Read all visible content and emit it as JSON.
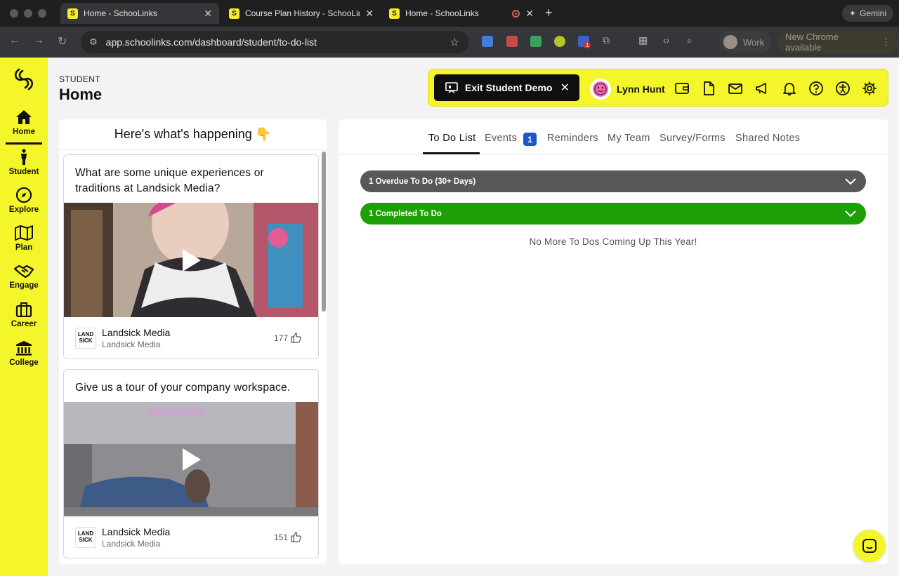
{
  "browser": {
    "tabs": [
      {
        "title": "Home - SchooLinks",
        "fav": "S"
      },
      {
        "title": "Course Plan History - SchooLinks",
        "fav": "S"
      },
      {
        "title": "Home - SchooLinks",
        "fav": "S"
      }
    ],
    "gemini_label": "Gemini",
    "url": "app.schoolinks.com/dashboard/student/to-do-list",
    "profile_label": "Work",
    "update_label": "New Chrome available",
    "ext_badge": "1"
  },
  "sidebar": {
    "items": [
      {
        "label": "Home"
      },
      {
        "label": "Student"
      },
      {
        "label": "Explore"
      },
      {
        "label": "Plan"
      },
      {
        "label": "Engage"
      },
      {
        "label": "Career"
      },
      {
        "label": "College"
      }
    ]
  },
  "header": {
    "subtitle": "STUDENT",
    "title": "Home",
    "exit_demo_label": "Exit Student Demo",
    "user_name": "Lynn Hunt"
  },
  "feed": {
    "title": "Here's what's happening 👇",
    "cards": [
      {
        "question": "What are some unique experiences or traditions at Landsick Media?",
        "org": "Landsick Media",
        "org_sub": "Landsick Media",
        "likes": "177",
        "logo_text": "LAND SICK"
      },
      {
        "question": "Give us a tour of your company workspace.",
        "org": "Landsick Media",
        "org_sub": "Landsick Media",
        "likes": "151",
        "logo_text": "LAND SICK"
      }
    ]
  },
  "main": {
    "tabs": [
      {
        "label": "To Do List"
      },
      {
        "label": "Events"
      },
      {
        "label": "Reminders"
      },
      {
        "label": "My Team"
      },
      {
        "label": "Survey/Forms"
      },
      {
        "label": "Shared Notes"
      }
    ],
    "events_badge": "1",
    "overdue_label": "1 Overdue To Do (30+ Days)",
    "completed_label": "1 Completed To Do",
    "empty_message": "No More To Dos Coming Up This Year!"
  },
  "colors": {
    "brand_yellow": "#f4f52a",
    "overdue_gray": "#585858",
    "completed_green": "#1e9f07",
    "badge_blue": "#1d57c9"
  }
}
